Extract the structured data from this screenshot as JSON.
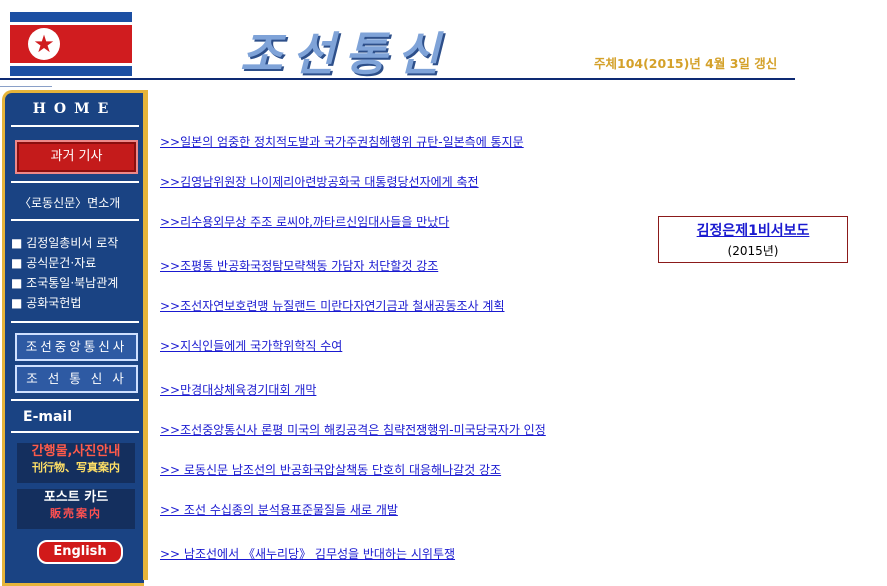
{
  "header": {
    "logo_text": "조선통신",
    "date_text": "주체104(2015)년 4월 3일 갱신"
  },
  "sidebar": {
    "home_label": "HOME",
    "archive_button": "과거 기사",
    "rodong_link": "〈로동신문〉면소개",
    "items": [
      "김정일총비서 로작",
      "공식문건·자료",
      "조국통일·북남관계",
      "공화국헌법"
    ],
    "kcna_button": "조선중앙통신사",
    "korea_news_button": "조 선 통 신 사",
    "email_label": "E-mail",
    "banner1": {
      "line1": "간행물,사진안내",
      "line2": "刊行物、写真案内"
    },
    "banner2": {
      "line1": "포스트 카드",
      "line2": "販売案内"
    },
    "english_button": "English"
  },
  "news": [
    ">>일본의 엄중한 정치적도발과 국가주권침해행위 규탄-일본측에 통지문",
    ">>김영남위원장 나이제리아련방공화국 대통령당선자에게 축전",
    ">>리수용외무상 주조 로씨야,까타르신임대사들을 만났다",
    ">>조평통 반공화국정탐모략책동 가담자 처단할것 강조",
    ">>조선자연보호련맹 뉴질랜드 미란다자연기금과 철새공동조사 계획",
    ">>지식인들에게 국가학위학직 수여",
    ">>만경대상체육경기대회 개막",
    ">>조선중앙통신사 론평 미국의 해킹공격은 침략전쟁행위-미국당국자가 인정",
    ">> 로동신문 남조선의 반공화국압살책동 단호히 대응해나갈것 강조",
    ">> 조선 수십종의 분석용표준물질들 새로 개발",
    ">> 남조선에서 《새누리당》 김무성을 반대하는 시위투쟁"
  ],
  "feature_box": {
    "link": "김정은제1비서보도",
    "year": "(2015년)"
  },
  "colors": {
    "sidebar_bg": "#1a4383",
    "sidebar_border": "#e6b43a",
    "link": "#1a1ad0",
    "date": "#d4a12a",
    "flag_red": "#d01c1f",
    "flag_blue": "#1c4fa3"
  }
}
